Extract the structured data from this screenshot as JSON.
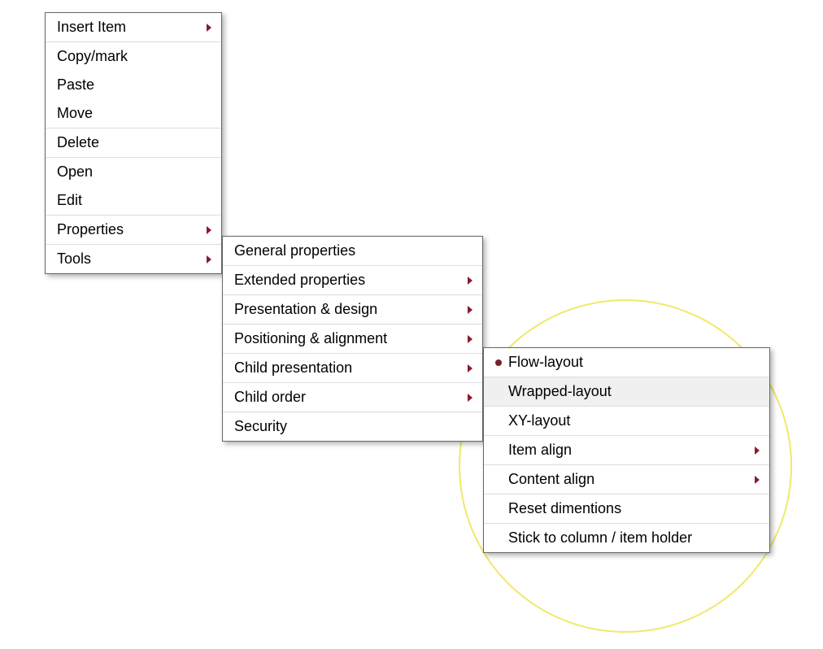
{
  "menu1": {
    "items": [
      {
        "label": "Insert Item",
        "submenu": true
      },
      {
        "label": "Copy/mark"
      },
      {
        "label": "Paste"
      },
      {
        "label": "Move"
      },
      {
        "label": "Delete"
      },
      {
        "label": "Open"
      },
      {
        "label": "Edit"
      },
      {
        "label": "Properties",
        "submenu": true
      },
      {
        "label": "Tools",
        "submenu": true
      }
    ]
  },
  "menu2": {
    "items": [
      {
        "label": "General properties"
      },
      {
        "label": "Extended properties",
        "submenu": true
      },
      {
        "label": "Presentation & design",
        "submenu": true
      },
      {
        "label": "Positioning & alignment",
        "submenu": true
      },
      {
        "label": "Child presentation",
        "submenu": true
      },
      {
        "label": "Child order",
        "submenu": true
      },
      {
        "label": "Security"
      }
    ]
  },
  "menu3": {
    "items": [
      {
        "label": "Flow-layout",
        "bullet": true
      },
      {
        "label": "Wrapped-layout",
        "highlighted": true
      },
      {
        "label": "XY-layout"
      },
      {
        "label": "Item align",
        "submenu": true
      },
      {
        "label": "Content align",
        "submenu": true
      },
      {
        "label": "Reset dimentions"
      },
      {
        "label": "Stick to column / item holder"
      }
    ]
  },
  "annotations": {
    "circle_color": "#f0e96a"
  }
}
